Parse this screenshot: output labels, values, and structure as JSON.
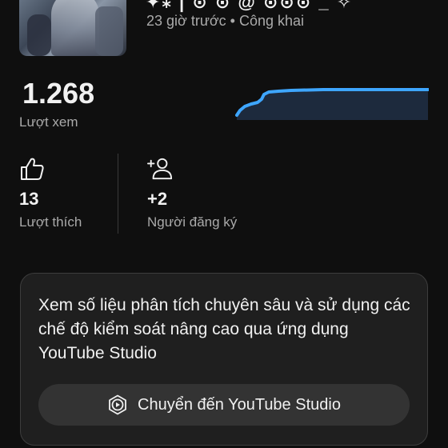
{
  "video": {
    "title_fragment": "✦⁎ | ⊙ ⊙ @ ⊙⊙⊙ _ ✧",
    "meta": "23 giờ trước • Công khai"
  },
  "views": {
    "value": "1.268",
    "label": "Lượt xem"
  },
  "stats": {
    "likes": {
      "value": "13",
      "label": "Lượt thích",
      "icon": "thumbs-up-icon"
    },
    "subscribers": {
      "value": "+2",
      "label": "Người đăng ký",
      "icon": "add-person-icon"
    }
  },
  "studio_card": {
    "text": "Xem số liệu phân tích chuyên sâu và sử dụng các chế độ kiểm soát nâng cao qua ứng dụng YouTube Studio",
    "button_label": "Chuyển đến YouTube Studio",
    "button_icon": "youtube-studio-icon"
  },
  "colors": {
    "background": "#0f0f0f",
    "accent_line": "#3ea6ff",
    "card_background": "#1f1f1f",
    "secondary_text": "#aaaaaa"
  }
}
